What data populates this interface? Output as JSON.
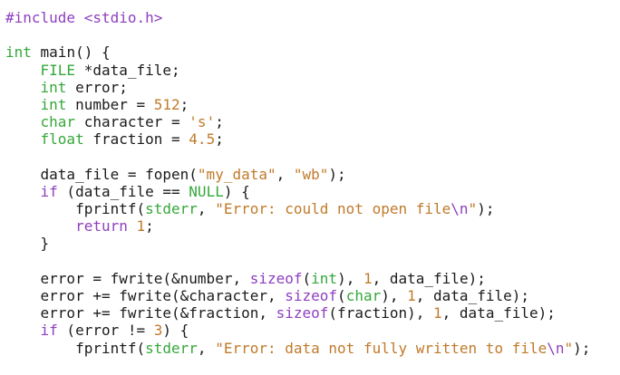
{
  "colors": {
    "background": "#ffffff",
    "plain": "#1b1b1b",
    "keyword": "#8f3fbf",
    "type": "#35a83a",
    "string": "#c07a2a",
    "number": "#c07a2a",
    "escape": "#8f3fbf"
  },
  "code": {
    "lines": [
      [
        [
          "#include ",
          "keyword"
        ],
        [
          "<stdio.h>",
          "keyword"
        ]
      ],
      [],
      [
        [
          "int",
          "type"
        ],
        [
          " main() {",
          "plain"
        ]
      ],
      [
        [
          "    ",
          "plain"
        ],
        [
          "FILE",
          "type"
        ],
        [
          " *data_file;",
          "plain"
        ]
      ],
      [
        [
          "    ",
          "plain"
        ],
        [
          "int",
          "type"
        ],
        [
          " error;",
          "plain"
        ]
      ],
      [
        [
          "    ",
          "plain"
        ],
        [
          "int",
          "type"
        ],
        [
          " number = ",
          "plain"
        ],
        [
          "512",
          "number"
        ],
        [
          ";",
          "plain"
        ]
      ],
      [
        [
          "    ",
          "plain"
        ],
        [
          "char",
          "type"
        ],
        [
          " character = ",
          "plain"
        ],
        [
          "'s'",
          "string"
        ],
        [
          ";",
          "plain"
        ]
      ],
      [
        [
          "    ",
          "plain"
        ],
        [
          "float",
          "type"
        ],
        [
          " fraction = ",
          "plain"
        ],
        [
          "4.5",
          "number"
        ],
        [
          ";",
          "plain"
        ]
      ],
      [],
      [
        [
          "    data_file = fopen(",
          "plain"
        ],
        [
          "\"my_data\"",
          "string"
        ],
        [
          ", ",
          "plain"
        ],
        [
          "\"wb\"",
          "string"
        ],
        [
          ");",
          "plain"
        ]
      ],
      [
        [
          "    ",
          "plain"
        ],
        [
          "if",
          "keyword"
        ],
        [
          " (data_file == ",
          "plain"
        ],
        [
          "NULL",
          "type"
        ],
        [
          ") {",
          "plain"
        ]
      ],
      [
        [
          "        fprintf(",
          "plain"
        ],
        [
          "stderr",
          "type"
        ],
        [
          ", ",
          "plain"
        ],
        [
          "\"Error: could not open file",
          "string"
        ],
        [
          "\\n",
          "escape"
        ],
        [
          "\"",
          "string"
        ],
        [
          ");",
          "plain"
        ]
      ],
      [
        [
          "        ",
          "plain"
        ],
        [
          "return",
          "keyword"
        ],
        [
          " ",
          "plain"
        ],
        [
          "1",
          "number"
        ],
        [
          ";",
          "plain"
        ]
      ],
      [
        [
          "    }",
          "plain"
        ]
      ],
      [],
      [
        [
          "    error = fwrite(&number, ",
          "plain"
        ],
        [
          "sizeof",
          "keyword"
        ],
        [
          "(",
          "plain"
        ],
        [
          "int",
          "type"
        ],
        [
          "), ",
          "plain"
        ],
        [
          "1",
          "number"
        ],
        [
          ", data_file);",
          "plain"
        ]
      ],
      [
        [
          "    error += fwrite(&character, ",
          "plain"
        ],
        [
          "sizeof",
          "keyword"
        ],
        [
          "(",
          "plain"
        ],
        [
          "char",
          "type"
        ],
        [
          "), ",
          "plain"
        ],
        [
          "1",
          "number"
        ],
        [
          ", data_file);",
          "plain"
        ]
      ],
      [
        [
          "    error += fwrite(&fraction, ",
          "plain"
        ],
        [
          "sizeof",
          "keyword"
        ],
        [
          "(fraction), ",
          "plain"
        ],
        [
          "1",
          "number"
        ],
        [
          ", data_file);",
          "plain"
        ]
      ],
      [
        [
          "    ",
          "plain"
        ],
        [
          "if",
          "keyword"
        ],
        [
          " (error != ",
          "plain"
        ],
        [
          "3",
          "number"
        ],
        [
          ") {",
          "plain"
        ]
      ],
      [
        [
          "        fprintf(",
          "plain"
        ],
        [
          "stderr",
          "type"
        ],
        [
          ", ",
          "plain"
        ],
        [
          "\"Error: data not fully written to file",
          "string"
        ],
        [
          "\\n",
          "escape"
        ],
        [
          "\"",
          "string"
        ],
        [
          ");",
          "plain"
        ]
      ]
    ]
  }
}
